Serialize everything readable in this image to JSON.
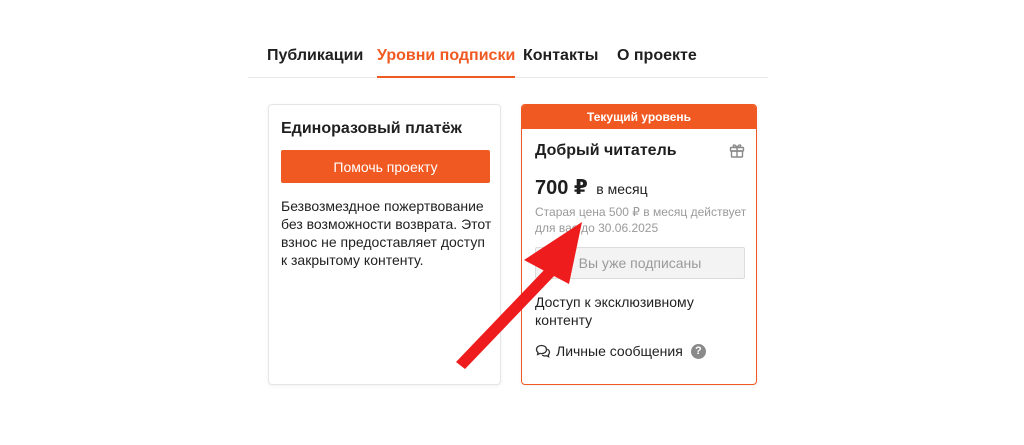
{
  "tabs": [
    {
      "label": "Публикации",
      "active": false
    },
    {
      "label": "Уровни подписки",
      "active": true
    },
    {
      "label": "Контакты",
      "active": false
    },
    {
      "label": "О проекте",
      "active": false
    }
  ],
  "one_time": {
    "title": "Единоразовый платёж",
    "button_label": "Помочь проекту",
    "description": "Безвозмездное пожертвование без возможности возврата. Этот взнос не предоставляет доступ к закрытому контенту."
  },
  "tier": {
    "badge": "Текущий уровень",
    "name": "Добрый читатель",
    "price": "700 ₽",
    "period": "в месяц",
    "old_price_note": "Старая цена 500 ₽ в месяц действует для вас до 30.06.2025",
    "button_label": "Вы уже подписаны",
    "perk_1": "Доступ к эксклюзивному контенту",
    "perk_2": "Личные сообщения",
    "help_glyph": "?",
    "icons": [
      "gift-icon",
      "chat-icon",
      "help-icon"
    ]
  },
  "colors": {
    "accent": "#f05a22",
    "annotation_arrow": "#ee1c1c",
    "muted_text": "#9a9a9a"
  }
}
